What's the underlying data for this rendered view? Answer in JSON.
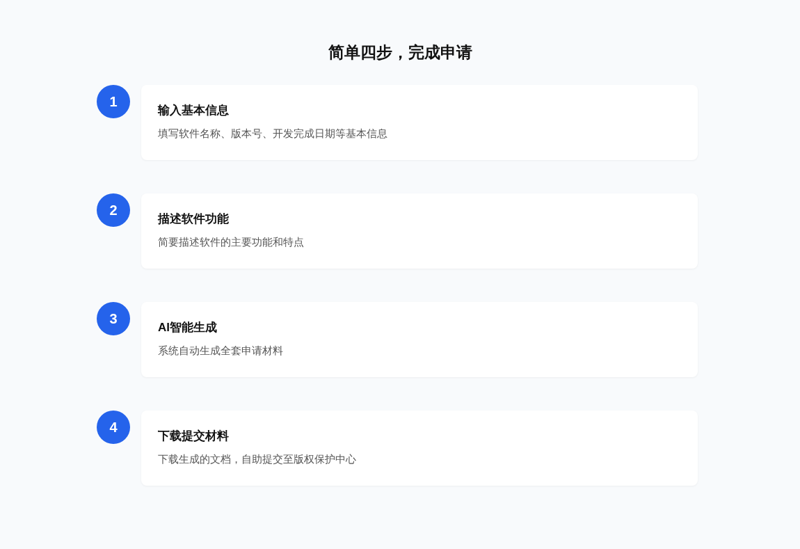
{
  "title": "简单四步，完成申请",
  "steps": [
    {
      "number": "1",
      "title": "输入基本信息",
      "description": "填写软件名称、版本号、开发完成日期等基本信息"
    },
    {
      "number": "2",
      "title": "描述软件功能",
      "description": "简要描述软件的主要功能和特点"
    },
    {
      "number": "3",
      "title": "AI智能生成",
      "description": "系统自动生成全套申请材料"
    },
    {
      "number": "4",
      "title": "下载提交材料",
      "description": "下载生成的文档，自助提交至版权保护中心"
    }
  ]
}
